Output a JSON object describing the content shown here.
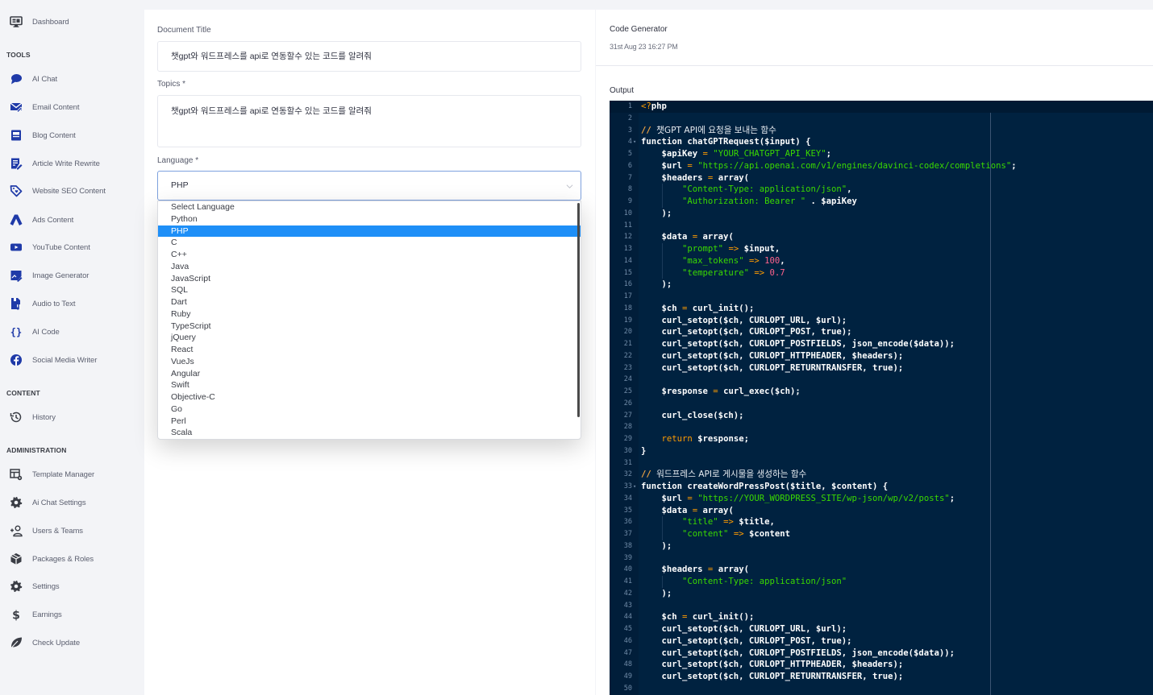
{
  "sidebar": {
    "dashboard": {
      "label": "Dashboard",
      "icon": "monitor-icon"
    },
    "sections": [
      {
        "title": "TOOLS",
        "items": [
          {
            "label": "AI Chat",
            "icon": "chat-bubble-icon"
          },
          {
            "label": "Email Content",
            "icon": "email-icon"
          },
          {
            "label": "Blog Content",
            "icon": "blog-icon"
          },
          {
            "label": "Article Write Rewrite",
            "icon": "edit-document-icon"
          },
          {
            "label": "Website SEO Content",
            "icon": "tag-icon"
          },
          {
            "label": "Ads Content",
            "icon": "ads-icon"
          },
          {
            "label": "YouTube Content",
            "icon": "youtube-icon"
          },
          {
            "label": "Image Generator",
            "icon": "image-edit-icon"
          },
          {
            "label": "Audio to Text",
            "icon": "audio-file-icon"
          },
          {
            "label": "AI Code",
            "icon": "code-braces-icon"
          },
          {
            "label": "Social Media Writer",
            "icon": "facebook-icon"
          }
        ]
      },
      {
        "title": "CONTENT",
        "items": [
          {
            "label": "History",
            "icon": "history-icon"
          }
        ]
      },
      {
        "title": "ADMINISTRATION",
        "items": [
          {
            "label": "Template Manager",
            "icon": "template-settings-icon"
          },
          {
            "label": "Ai Chat Settings",
            "icon": "gear-icon"
          },
          {
            "label": "Users & Teams",
            "icon": "add-user-icon"
          },
          {
            "label": "Packages & Roles",
            "icon": "package-icon"
          },
          {
            "label": "Settings",
            "icon": "gear-icon"
          },
          {
            "label": "Earnings",
            "icon": "dollar-icon"
          },
          {
            "label": "Check Update",
            "icon": "leaf-icon"
          }
        ]
      }
    ],
    "accent_color": "#1f3aa8"
  },
  "form": {
    "document_title_label": "Document Title",
    "document_title_value": "챗gpt와 워드프레스를 api로 연동할수 있는 코드를 알려줘",
    "topics_label": "Topics *",
    "topics_value": "챗gpt와 워드프레스를 api로 연동할수 있는 코드를 알려줘",
    "language_label": "Language *",
    "language_value": "PHP",
    "language_options": [
      "Select Language",
      "Python",
      "PHP",
      "C",
      "C++",
      "Java",
      "JavaScript",
      "SQL",
      "Dart",
      "Ruby",
      "TypeScript",
      "jQuery",
      "React",
      "VueJs",
      "Angular",
      "Swift",
      "Objective-C",
      "Go",
      "Perl",
      "Scala"
    ],
    "selected_option": "PHP",
    "selection_color": "#1e8ff7"
  },
  "output": {
    "title": "Code Generator",
    "date": "31st Aug 23 16:27 PM",
    "label": "Output",
    "editor_theme": {
      "background": "#002240",
      "string": "#3ad900",
      "comment": "#f4a742",
      "number": "#ff628c",
      "keyword": "#ff9d00"
    },
    "code_lines": [
      [
        [
          "tag",
          "<?"
        ],
        [
          "plain",
          "php"
        ]
      ],
      [],
      [
        [
          "comment",
          "// "
        ],
        [
          "comment_ko",
          "챗GPT API에 요청을 보내는 함수"
        ]
      ],
      [
        [
          "plain",
          "function chatGPTRequest($input) {"
        ]
      ],
      [
        [
          "plain",
          "    $apiKey "
        ],
        [
          "op",
          "="
        ],
        [
          "plain",
          " "
        ],
        [
          "string",
          "\"YOUR_CHATGPT_API_KEY\""
        ],
        [
          "plain",
          ";"
        ]
      ],
      [
        [
          "plain",
          "    $url "
        ],
        [
          "op",
          "="
        ],
        [
          "plain",
          " "
        ],
        [
          "string",
          "\"https://api.openai.com/v1/engines/davinci-codex/completions\""
        ],
        [
          "plain",
          ";"
        ]
      ],
      [
        [
          "plain",
          "    $headers "
        ],
        [
          "op",
          "="
        ],
        [
          "plain",
          " array("
        ]
      ],
      [
        [
          "plain",
          "        "
        ],
        [
          "string",
          "\"Content-Type: application/json\""
        ],
        [
          "plain",
          ","
        ]
      ],
      [
        [
          "plain",
          "        "
        ],
        [
          "string",
          "\"Authorization: Bearer \""
        ],
        [
          "plain",
          " . $apiKey"
        ]
      ],
      [
        [
          "plain",
          "    );"
        ]
      ],
      [],
      [
        [
          "plain",
          "    $data "
        ],
        [
          "op",
          "="
        ],
        [
          "plain",
          " array("
        ]
      ],
      [
        [
          "plain",
          "        "
        ],
        [
          "string",
          "\"prompt\""
        ],
        [
          "plain",
          " "
        ],
        [
          "op",
          "=>"
        ],
        [
          "plain",
          " $input,"
        ]
      ],
      [
        [
          "plain",
          "        "
        ],
        [
          "string",
          "\"max_tokens\""
        ],
        [
          "plain",
          " "
        ],
        [
          "op",
          "=>"
        ],
        [
          "plain",
          " "
        ],
        [
          "number",
          "100"
        ],
        [
          "plain",
          ","
        ]
      ],
      [
        [
          "plain",
          "        "
        ],
        [
          "string",
          "\"temperature\""
        ],
        [
          "plain",
          " "
        ],
        [
          "op",
          "=>"
        ],
        [
          "plain",
          " "
        ],
        [
          "number",
          "0.7"
        ]
      ],
      [
        [
          "plain",
          "    );"
        ]
      ],
      [],
      [
        [
          "plain",
          "    $ch "
        ],
        [
          "op",
          "="
        ],
        [
          "plain",
          " curl_init();"
        ]
      ],
      [
        [
          "plain",
          "    curl_setopt($ch, CURLOPT_URL, $url);"
        ]
      ],
      [
        [
          "plain",
          "    curl_setopt($ch, CURLOPT_POST, true);"
        ]
      ],
      [
        [
          "plain",
          "    curl_setopt($ch, CURLOPT_POSTFIELDS, json_encode($data));"
        ]
      ],
      [
        [
          "plain",
          "    curl_setopt($ch, CURLOPT_HTTPHEADER, $headers);"
        ]
      ],
      [
        [
          "plain",
          "    curl_setopt($ch, CURLOPT_RETURNTRANSFER, true);"
        ]
      ],
      [],
      [
        [
          "plain",
          "    $response "
        ],
        [
          "op",
          "="
        ],
        [
          "plain",
          " curl_exec($ch);"
        ]
      ],
      [],
      [
        [
          "plain",
          "    curl_close($ch);"
        ]
      ],
      [],
      [
        [
          "plain",
          "    "
        ],
        [
          "keyword",
          "return"
        ],
        [
          "plain",
          " $response;"
        ]
      ],
      [
        [
          "plain",
          "}"
        ]
      ],
      [],
      [
        [
          "comment",
          "// "
        ],
        [
          "comment_ko",
          "워드프레스 API로 게시물을 생성하는 함수"
        ]
      ],
      [
        [
          "plain",
          "function createWordPressPost($title, $content) {"
        ]
      ],
      [
        [
          "plain",
          "    $url "
        ],
        [
          "op",
          "="
        ],
        [
          "plain",
          " "
        ],
        [
          "string",
          "\"https://YOUR_WORDPRESS_SITE/wp-json/wp/v2/posts\""
        ],
        [
          "plain",
          ";"
        ]
      ],
      [
        [
          "plain",
          "    $data "
        ],
        [
          "op",
          "="
        ],
        [
          "plain",
          " array("
        ]
      ],
      [
        [
          "plain",
          "        "
        ],
        [
          "string",
          "\"title\""
        ],
        [
          "plain",
          " "
        ],
        [
          "op",
          "=>"
        ],
        [
          "plain",
          " $title,"
        ]
      ],
      [
        [
          "plain",
          "        "
        ],
        [
          "string",
          "\"content\""
        ],
        [
          "plain",
          " "
        ],
        [
          "op",
          "=>"
        ],
        [
          "plain",
          " $content"
        ]
      ],
      [
        [
          "plain",
          "    );"
        ]
      ],
      [],
      [
        [
          "plain",
          "    $headers "
        ],
        [
          "op",
          "="
        ],
        [
          "plain",
          " array("
        ]
      ],
      [
        [
          "plain",
          "        "
        ],
        [
          "string",
          "\"Content-Type: application/json\""
        ]
      ],
      [
        [
          "plain",
          "    );"
        ]
      ],
      [],
      [
        [
          "plain",
          "    $ch "
        ],
        [
          "op",
          "="
        ],
        [
          "plain",
          " curl_init();"
        ]
      ],
      [
        [
          "plain",
          "    curl_setopt($ch, CURLOPT_URL, $url);"
        ]
      ],
      [
        [
          "plain",
          "    curl_setopt($ch, CURLOPT_POST, true);"
        ]
      ],
      [
        [
          "plain",
          "    curl_setopt($ch, CURLOPT_POSTFIELDS, json_encode($data));"
        ]
      ],
      [
        [
          "plain",
          "    curl_setopt($ch, CURLOPT_HTTPHEADER, $headers);"
        ]
      ],
      [
        [
          "plain",
          "    curl_setopt($ch, CURLOPT_RETURNTRANSFER, true);"
        ]
      ],
      []
    ],
    "fold_lines": [
      4,
      33
    ],
    "active_line": 1
  }
}
